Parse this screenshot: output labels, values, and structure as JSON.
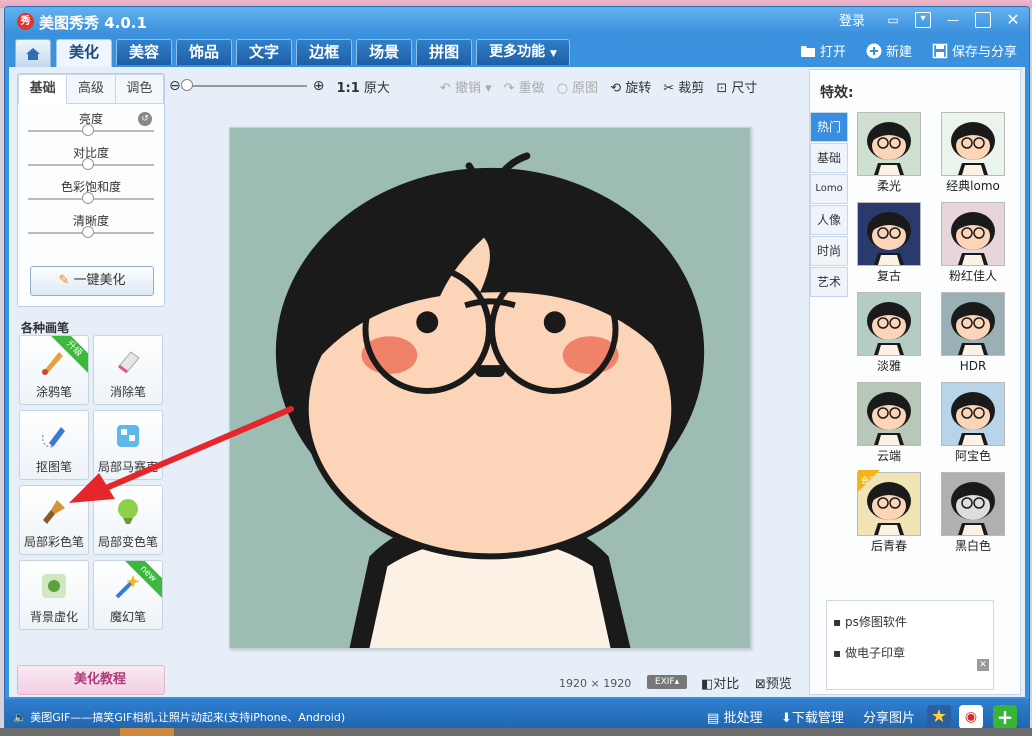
{
  "app": {
    "title": "美图秀秀 4.0.1",
    "login": "登录"
  },
  "nav": {
    "tabs": [
      "美化",
      "美容",
      "饰品",
      "文字",
      "边框",
      "场景",
      "拼图"
    ],
    "more": "更多功能",
    "actions": {
      "open": "打开",
      "new": "新建",
      "save": "保存与分享"
    }
  },
  "left": {
    "tabs": [
      "基础",
      "高级",
      "调色"
    ],
    "sliders": [
      "亮度",
      "对比度",
      "色彩饱和度",
      "清晰度"
    ],
    "one_click": "一键美化",
    "brush_title": "各种画笔",
    "brushes": [
      {
        "label": "涂鸦笔",
        "badge": "升级"
      },
      {
        "label": "消除笔",
        "badge": ""
      },
      {
        "label": "抠图笔",
        "badge": ""
      },
      {
        "label": "局部马赛克",
        "badge": ""
      },
      {
        "label": "局部彩色笔",
        "badge": ""
      },
      {
        "label": "局部变色笔",
        "badge": ""
      },
      {
        "label": "背景虚化",
        "badge": ""
      },
      {
        "label": "魔幻笔",
        "badge": "new"
      }
    ],
    "tutorial": "美化教程"
  },
  "toolbar": {
    "zoom_1to1": "1:1",
    "original_size": "原大",
    "undo": "撤销",
    "redo": "重做",
    "original": "原图",
    "rotate": "旋转",
    "crop": "裁剪",
    "resize": "尺寸"
  },
  "canvas": {
    "width": "1920",
    "times": "×",
    "height": "1920",
    "exif": "EXIF",
    "compare": "对比",
    "preview": "预览"
  },
  "effects": {
    "title": "特效:",
    "tabs": [
      "热门",
      "基础",
      "Lomo",
      "人像",
      "时尚",
      "艺术"
    ],
    "items": [
      {
        "label": "柔光"
      },
      {
        "label": "经典lomo"
      },
      {
        "label": "复古"
      },
      {
        "label": "粉红佳人"
      },
      {
        "label": "淡雅"
      },
      {
        "label": "HDR"
      },
      {
        "label": "云端"
      },
      {
        "label": "阿宝色"
      },
      {
        "label": "后青春",
        "vip": "会员"
      },
      {
        "label": "黑白色"
      }
    ],
    "ad": [
      "ps修图软件",
      "做电子印章"
    ]
  },
  "status": {
    "message": "美图GIF——搞笑GIF相机,让照片动起来(支持iPhone、Android)",
    "batch": "批处理",
    "download": "下载管理",
    "share": "分享图片"
  },
  "colors": {
    "accent": "#3a92df",
    "selection_arrow": "#e5262b",
    "photo_bg": "#9cbcb4",
    "face": "#fcd5b8"
  }
}
